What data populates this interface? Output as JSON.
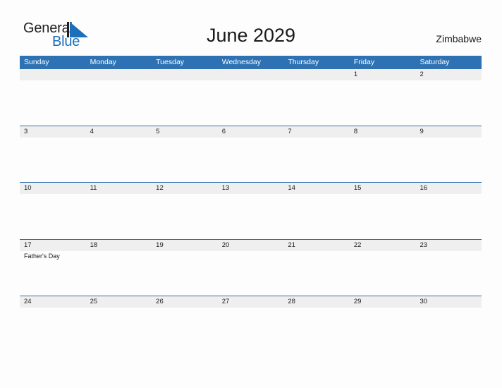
{
  "brand": {
    "word_one": "General",
    "word_two": "Blue",
    "mark_icon": "triangle-flag-icon",
    "colors": {
      "blue": "#1c6fba",
      "black": "#231f20"
    }
  },
  "header": {
    "title": "June 2029",
    "country": "Zimbabwe"
  },
  "calendar": {
    "accent_color": "#2e72b3",
    "band_color": "#efefef",
    "weekday_headers": [
      "Sunday",
      "Monday",
      "Tuesday",
      "Wednesday",
      "Thursday",
      "Friday",
      "Saturday"
    ],
    "weeks": [
      {
        "days": [
          {
            "num": "",
            "events": []
          },
          {
            "num": "",
            "events": []
          },
          {
            "num": "",
            "events": []
          },
          {
            "num": "",
            "events": []
          },
          {
            "num": "",
            "events": []
          },
          {
            "num": "1",
            "events": []
          },
          {
            "num": "2",
            "events": []
          }
        ]
      },
      {
        "days": [
          {
            "num": "3",
            "events": []
          },
          {
            "num": "4",
            "events": []
          },
          {
            "num": "5",
            "events": []
          },
          {
            "num": "6",
            "events": []
          },
          {
            "num": "7",
            "events": []
          },
          {
            "num": "8",
            "events": []
          },
          {
            "num": "9",
            "events": []
          }
        ]
      },
      {
        "days": [
          {
            "num": "10",
            "events": []
          },
          {
            "num": "11",
            "events": []
          },
          {
            "num": "12",
            "events": []
          },
          {
            "num": "13",
            "events": []
          },
          {
            "num": "14",
            "events": []
          },
          {
            "num": "15",
            "events": []
          },
          {
            "num": "16",
            "events": []
          }
        ]
      },
      {
        "days": [
          {
            "num": "17",
            "events": [
              "Father's Day"
            ]
          },
          {
            "num": "18",
            "events": []
          },
          {
            "num": "19",
            "events": []
          },
          {
            "num": "20",
            "events": []
          },
          {
            "num": "21",
            "events": []
          },
          {
            "num": "22",
            "events": []
          },
          {
            "num": "23",
            "events": []
          }
        ]
      },
      {
        "days": [
          {
            "num": "24",
            "events": []
          },
          {
            "num": "25",
            "events": []
          },
          {
            "num": "26",
            "events": []
          },
          {
            "num": "27",
            "events": []
          },
          {
            "num": "28",
            "events": []
          },
          {
            "num": "29",
            "events": []
          },
          {
            "num": "30",
            "events": []
          }
        ]
      }
    ]
  }
}
